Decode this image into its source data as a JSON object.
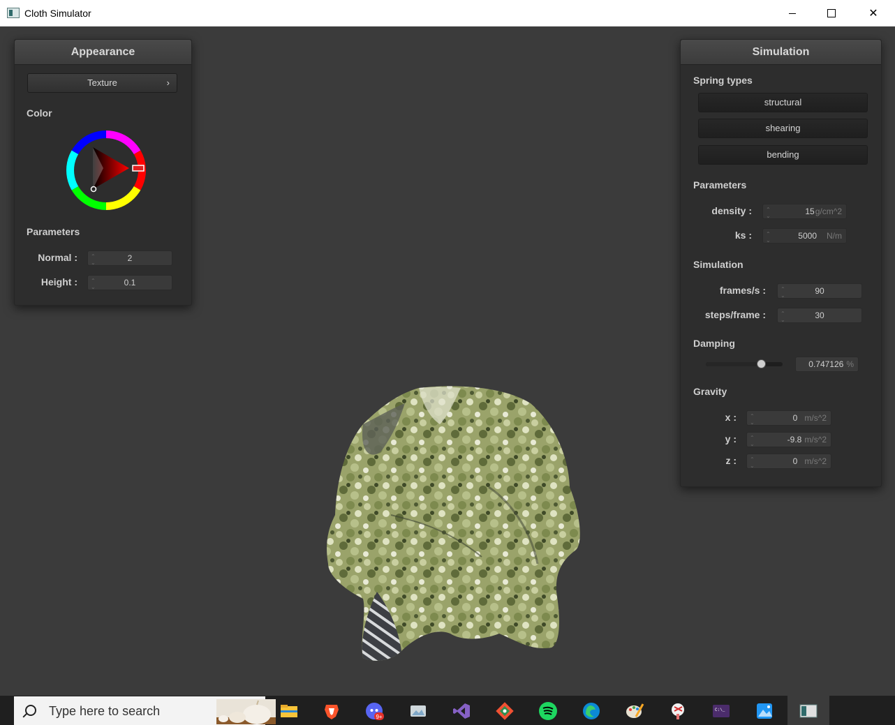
{
  "window": {
    "title": "Cloth Simulator"
  },
  "appearance": {
    "header": "Appearance",
    "texture_button": "Texture",
    "texture_chevron": "›",
    "color_label": "Color",
    "color_value": "#e02020",
    "parameters_label": "Parameters",
    "normal": {
      "label": "Normal :",
      "value": "2"
    },
    "height": {
      "label": "Height :",
      "value": "0.1"
    }
  },
  "simulation": {
    "header": "Simulation",
    "spring_types_label": "Spring types",
    "springs": [
      "structural",
      "shearing",
      "bending"
    ],
    "parameters_label": "Parameters",
    "density": {
      "label": "density :",
      "value": "15",
      "unit": "g/cm^2"
    },
    "ks": {
      "label": "ks :",
      "value": "5000",
      "unit": "N/m"
    },
    "simulation_label": "Simulation",
    "fps": {
      "label": "frames/s :",
      "value": "90"
    },
    "steps": {
      "label": "steps/frame :",
      "value": "30"
    },
    "damping_label": "Damping",
    "damping": {
      "value": "0.747126",
      "unit": "%",
      "slider_fraction": 0.75
    },
    "gravity_label": "Gravity",
    "gravity": [
      {
        "label": "x :",
        "value": "0",
        "unit": "m/s^2"
      },
      {
        "label": "y :",
        "value": "-9.8",
        "unit": "m/s^2"
      },
      {
        "label": "z :",
        "value": "0",
        "unit": "m/s^2"
      }
    ]
  },
  "taskbar": {
    "search_placeholder": "Type here to search",
    "icons": [
      "file-explorer-icon",
      "brave-icon",
      "discord-icon",
      "photos-icon",
      "visual-studio-icon",
      "git-icon",
      "spotify-icon",
      "edge-icon",
      "paint-icon",
      "snipping-icon",
      "terminal-icon",
      "photos-app-icon",
      "cloth-simulator-icon"
    ],
    "discord_badge": "9+"
  }
}
